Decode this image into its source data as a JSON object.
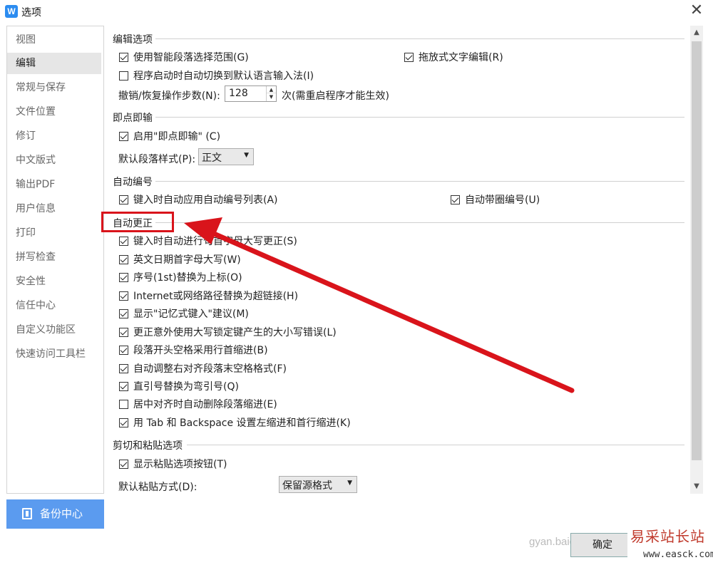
{
  "window": {
    "title": "选项",
    "app_icon": "wps-writer-icon"
  },
  "sidebar": {
    "items": [
      {
        "label": "视图"
      },
      {
        "label": "编辑",
        "active": true
      },
      {
        "label": "常规与保存"
      },
      {
        "label": "文件位置"
      },
      {
        "label": "修订"
      },
      {
        "label": "中文版式"
      },
      {
        "label": "输出PDF"
      },
      {
        "label": "用户信息"
      },
      {
        "label": "打印"
      },
      {
        "label": "拼写检查"
      },
      {
        "label": "安全性"
      },
      {
        "label": "信任中心"
      },
      {
        "label": "自定义功能区"
      },
      {
        "label": "快速访问工具栏"
      }
    ],
    "backup_label": "备份中心"
  },
  "content": {
    "edit_options": {
      "header": "编辑选项",
      "smart_select": {
        "label": "使用智能段落选择范围(G)",
        "checked": true
      },
      "drag_edit": {
        "label": "拖放式文字编辑(R)",
        "checked": true
      },
      "auto_ime": {
        "label": "程序启动时自动切换到默认语言输入法(I)",
        "checked": false
      },
      "undo_steps_label": "撤销/恢复操作步数(N):",
      "undo_steps_value": "128",
      "undo_steps_note": "次(需重启程序才能生效)"
    },
    "click_type": {
      "header": "即点即输",
      "enable": {
        "label": "启用\"即点即输\" (C)",
        "checked": true
      },
      "default_style_label": "默认段落样式(P):",
      "default_style_value": "正文"
    },
    "auto_number": {
      "header": "自动编号",
      "auto_list": {
        "label": "键入时自动应用自动编号列表(A)",
        "checked": true
      },
      "auto_circle": {
        "label": "自动带圈编号(U)",
        "checked": true
      }
    },
    "autocorrect": {
      "header": "自动更正",
      "items": [
        {
          "label": "键入时自动进行句首字母大写更正(S)",
          "checked": true
        },
        {
          "label": "英文日期首字母大写(W)",
          "checked": true
        },
        {
          "label": "序号(1st)替换为上标(O)",
          "checked": true
        },
        {
          "label": "Internet或网络路径替换为超链接(H)",
          "checked": true
        },
        {
          "label": "显示\"记忆式键入\"建议(M)",
          "checked": true
        },
        {
          "label": "更正意外使用大写锁定键产生的大小写错误(L)",
          "checked": true
        },
        {
          "label": "段落开头空格采用行首缩进(B)",
          "checked": true
        },
        {
          "label": "自动调整右对齐段落末空格格式(F)",
          "checked": true
        },
        {
          "label": "直引号替换为弯引号(Q)",
          "checked": true
        },
        {
          "label": "居中对齐时自动删除段落缩进(E)",
          "checked": false
        },
        {
          "label": "用 Tab 和 Backspace 设置左缩进和首行缩进(K)",
          "checked": true
        }
      ]
    },
    "cut_paste": {
      "header": "剪切和粘贴选项",
      "show_paste_btn": {
        "label": "显示粘贴选项按钮(T)",
        "checked": true
      },
      "default_paste_label": "默认粘贴方式(D):",
      "default_paste_value": "保留源格式"
    }
  },
  "footer": {
    "ok_label": "确定"
  },
  "watermark": {
    "title": "易采站长站",
    "url": "www.easck.com",
    "faint": "gyan.baidu"
  },
  "colors": {
    "accent": "#5b9bef",
    "annotation": "#d9141b",
    "active_nav": "#e6e6e6"
  }
}
